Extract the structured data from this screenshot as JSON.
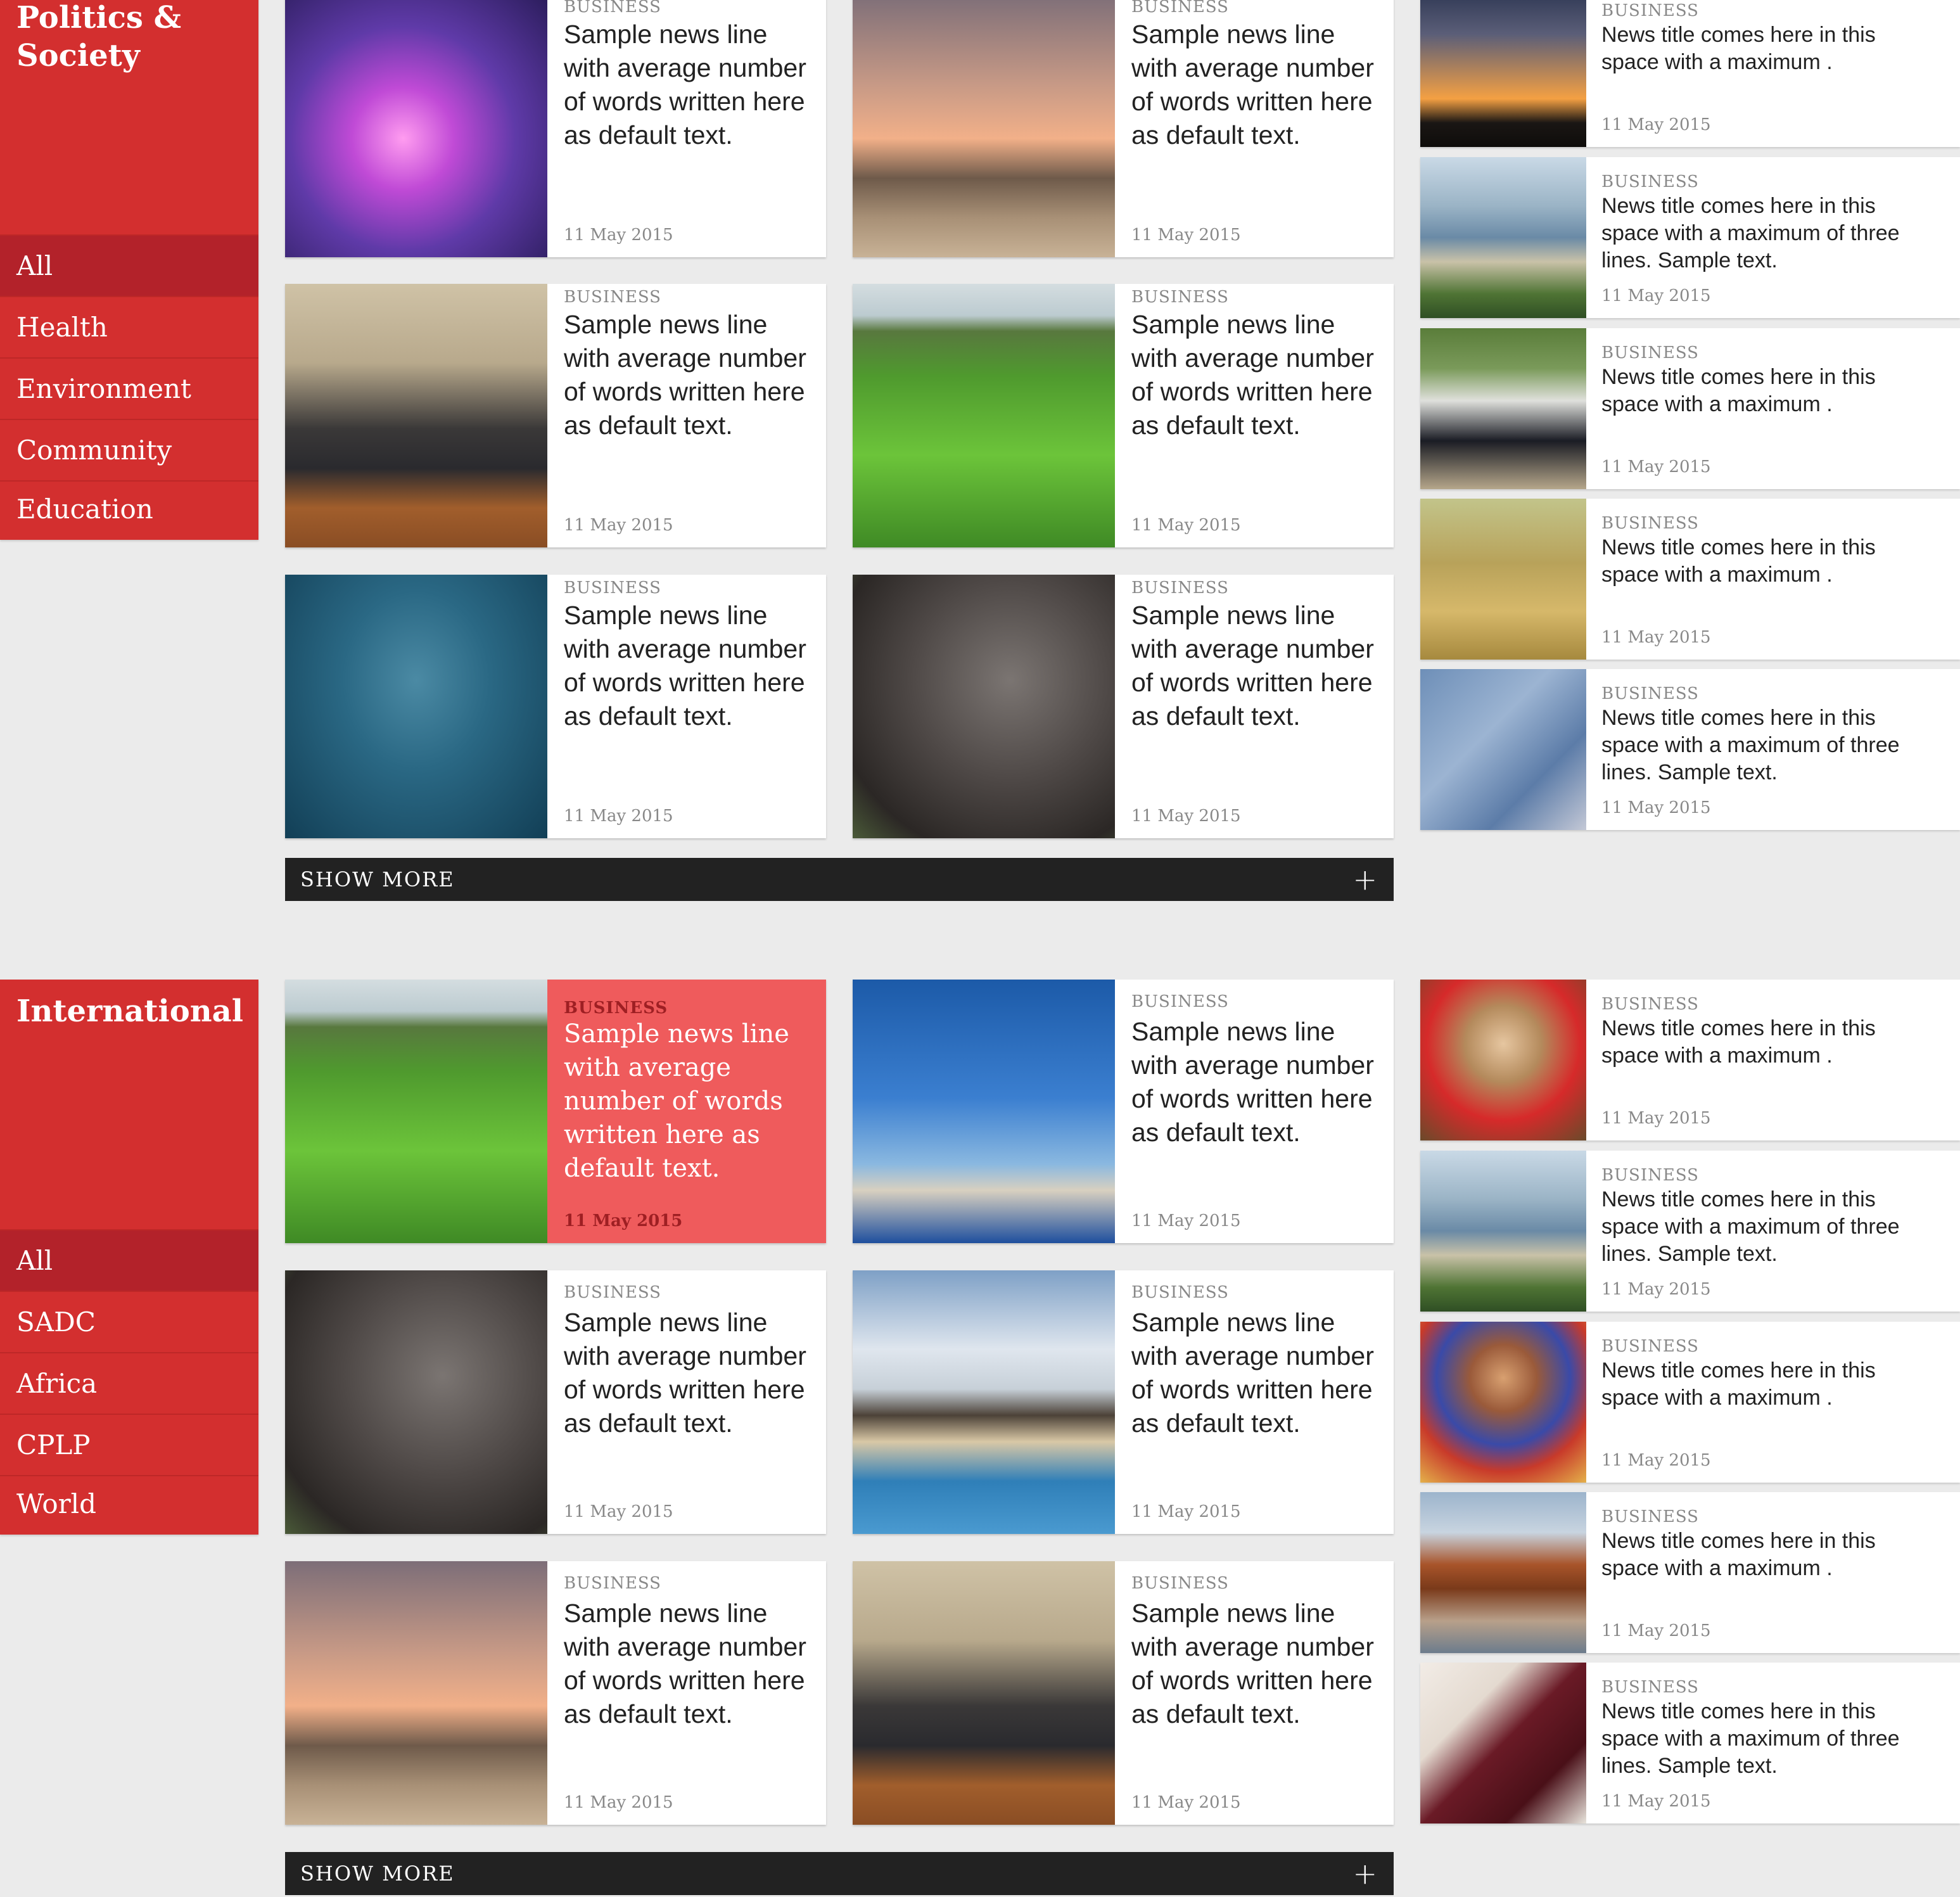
{
  "colors": {
    "brand_red": "#d32f2f",
    "sidebar_active": "#b3222a",
    "featured_bg": "#ef5b5c",
    "show_more_bg": "#222222",
    "page_bg": "#ebebeb"
  },
  "sections": [
    {
      "title": "Politics & Society",
      "nav": [
        "All",
        "Health",
        "Environment",
        "Community",
        "Education"
      ],
      "active_nav": "All",
      "cards": [
        {
          "category": "BUSINESS",
          "headline": "Sample news line with average number of words written here as default text.",
          "date": "11 May 2015",
          "image": "passport-uv-photo"
        },
        {
          "category": "BUSINESS",
          "headline": "Sample news line with average number of words written here as default text.",
          "date": "11 May 2015",
          "image": "beach-sunset-photo"
        },
        {
          "category": "BUSINESS",
          "headline": "Sample news line with average number of words written here as default text.",
          "date": "11 May 2015",
          "image": "speaker-podium-photo"
        },
        {
          "category": "BUSINESS",
          "headline": "Sample news line with average number of words written here as default text.",
          "date": "11 May 2015",
          "image": "crop-field-photo"
        },
        {
          "category": "BUSINESS",
          "headline": "Sample news line with average number of words written here as default text.",
          "date": "11 May 2015",
          "image": "tuna-school-photo"
        },
        {
          "category": "BUSINESS",
          "headline": "Sample news line with average number of words written here as default text.",
          "date": "11 May 2015",
          "image": "rhino-photo"
        }
      ],
      "show_more": "SHOW MORE",
      "side_list": [
        {
          "category": "BUSINESS",
          "headline": "News title comes here in this space with a maximum .",
          "date": "11 May 2015",
          "image": "city-sunset-photo"
        },
        {
          "category": "BUSINESS",
          "headline": "News title comes here in this space with a maximum of three lines. Sample text.",
          "date": "11 May 2015",
          "image": "lake-shore-photo"
        },
        {
          "category": "BUSINESS",
          "headline": "News title comes here in this space with a maximum .",
          "date": "11 May 2015",
          "image": "police-line-photo"
        },
        {
          "category": "BUSINESS",
          "headline": "News title comes here in this space with a maximum .",
          "date": "11 May 2015",
          "image": "deer-grass-photo"
        },
        {
          "category": "BUSINESS",
          "headline": "News title comes here in this space with a maximum of three lines. Sample text.",
          "date": "11 May 2015",
          "image": "banknotes-photo"
        }
      ]
    },
    {
      "title": "International",
      "nav": [
        "All",
        "SADC",
        "Africa",
        "CPLP",
        "World"
      ],
      "active_nav": "All",
      "cards": [
        {
          "category": "BUSINESS",
          "headline": "Sample news line with average number of words written here as default text.",
          "date": "11 May 2015",
          "image": "crop-field-photo",
          "featured": true
        },
        {
          "category": "BUSINESS",
          "headline": "Sample news line with average number of words written here as default text.",
          "date": "11 May 2015",
          "image": "woman-basin-photo"
        },
        {
          "category": "BUSINESS",
          "headline": "Sample news line with average number of words written here as default text.",
          "date": "11 May 2015",
          "image": "rhino-photo"
        },
        {
          "category": "BUSINESS",
          "headline": "Sample news line with average number of words written here as default text.",
          "date": "11 May 2015",
          "image": "lakeside-huts-photo"
        },
        {
          "category": "BUSINESS",
          "headline": "Sample news line with average number of words written here as default text.",
          "date": "11 May 2015",
          "image": "beach-sunset-photo"
        },
        {
          "category": "BUSINESS",
          "headline": "Sample news line with average number of words written here as default text.",
          "date": "11 May 2015",
          "image": "speaker-podium-photo"
        }
      ],
      "show_more": "SHOW MORE",
      "side_list": [
        {
          "category": "BUSINESS",
          "headline": "News title comes here in this space with a maximum .",
          "date": "11 May 2015",
          "image": "woman-hijab-photo"
        },
        {
          "category": "BUSINESS",
          "headline": "News title comes here in this space with a maximum of three lines. Sample text.",
          "date": "11 May 2015",
          "image": "lake-shore-photo"
        },
        {
          "category": "BUSINESS",
          "headline": "News title comes here in this space with a maximum .",
          "date": "11 May 2015",
          "image": "colorful-dress-photo"
        },
        {
          "category": "BUSINESS",
          "headline": "News title comes here in this space with a maximum .",
          "date": "11 May 2015",
          "image": "rock-arch-photo"
        },
        {
          "category": "BUSINESS",
          "headline": "News title comes here in this space with a maximum of three lines. Sample text.",
          "date": "11 May 2015",
          "image": "passport-photo"
        }
      ]
    }
  ]
}
